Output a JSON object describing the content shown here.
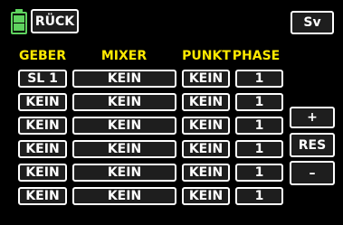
{
  "colors": {
    "accent": "#ffea00",
    "battery": "#5fd35f",
    "background": "#000000",
    "text": "#ffffff"
  },
  "top": {
    "back_label": "RÜCK",
    "save_label": "Sv",
    "battery_icon": "battery-icon"
  },
  "headers": {
    "geber": "GEBER",
    "mixer": "MIXER",
    "punkt": "PUNKT",
    "phase": "PHASE"
  },
  "rows": [
    {
      "geber": "SL 1",
      "mixer": "KEIN",
      "punkt": "KEIN",
      "phase": "1"
    },
    {
      "geber": "KEIN",
      "mixer": "KEIN",
      "punkt": "KEIN",
      "phase": "1"
    },
    {
      "geber": "KEIN",
      "mixer": "KEIN",
      "punkt": "KEIN",
      "phase": "1"
    },
    {
      "geber": "KEIN",
      "mixer": "KEIN",
      "punkt": "KEIN",
      "phase": "1"
    },
    {
      "geber": "KEIN",
      "mixer": "KEIN",
      "punkt": "KEIN",
      "phase": "1"
    },
    {
      "geber": "KEIN",
      "mixer": "KEIN",
      "punkt": "KEIN",
      "phase": "1"
    }
  ],
  "side": {
    "plus": "+",
    "reset": "RES",
    "minus": "–"
  }
}
